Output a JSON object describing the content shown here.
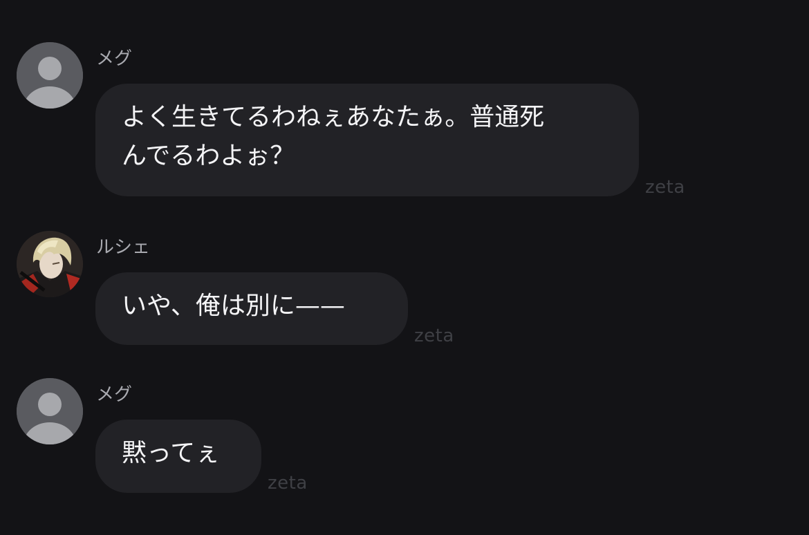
{
  "messages": [
    {
      "sender": "メグ",
      "avatar_icon": "default-user-icon",
      "text": "よく生きてるわねぇあなたぁ。普通死\nんでるわよぉ？",
      "tag": "zeta"
    },
    {
      "sender": "ルシェ",
      "avatar_icon": "character-portrait-icon",
      "text": "いや、俺は別に——",
      "tag": "zeta"
    },
    {
      "sender": "メグ",
      "avatar_icon": "default-user-icon",
      "text": "黙ってぇ",
      "tag": "zeta"
    }
  ],
  "colors": {
    "background": "#131316",
    "bubble": "#222226",
    "bubble_text": "#f4f4f6",
    "sender_text": "#a9aab0",
    "tag_text": "#3f4045",
    "default_avatar_bg": "#5a5b60",
    "default_avatar_fg": "#a7a8ac"
  }
}
